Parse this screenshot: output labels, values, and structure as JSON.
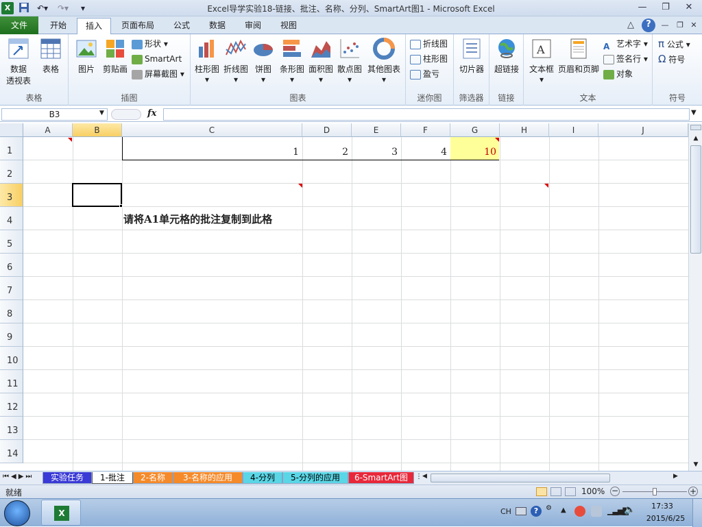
{
  "window": {
    "title": "Excel导学实验18-链接、批注、名称、分列、SmartArt图1 - Microsoft Excel",
    "minimize": "—",
    "restore": "❐",
    "close": "✕"
  },
  "ribbon_tabs": [
    "文件",
    "开始",
    "插入",
    "页面布局",
    "公式",
    "数据",
    "审阅",
    "视图"
  ],
  "active_tab": "插入",
  "help_icons": {
    "up": "△",
    "help": "?",
    "min": "—",
    "restore": "❐",
    "close": "✕"
  },
  "groups": {
    "tables": {
      "label": "表格",
      "pivot": "数据\n透视表",
      "pivot_line1": "数据",
      "pivot_line2": "透视表",
      "table": "表格"
    },
    "illustrations": {
      "label": "插图",
      "picture": "图片",
      "clipart": "剪贴画",
      "shapes": "形状",
      "smartart": "SmartArt",
      "screenshot": "屏幕截图"
    },
    "charts": {
      "label": "图表",
      "column": "柱形图",
      "line": "折线图",
      "pie": "饼图",
      "bar": "条形图",
      "area": "面积图",
      "scatter": "散点图",
      "other": "其他图表"
    },
    "sparklines": {
      "label": "迷你图",
      "line": "折线图",
      "column": "柱形图",
      "winloss": "盈亏"
    },
    "filter": {
      "label": "筛选器",
      "slicer": "切片器"
    },
    "links": {
      "label": "链接",
      "hyperlink": "超链接"
    },
    "text": {
      "label": "文本",
      "textbox": "文本框",
      "header_footer": "页眉和页脚",
      "wordart": "艺术字",
      "signature": "签名行",
      "object": "对象"
    },
    "symbols": {
      "label": "符号",
      "equation": "公式",
      "symbol": "符号"
    }
  },
  "formula_bar": {
    "name_box": "B3",
    "fx": "fx",
    "formula": ""
  },
  "columns": [
    "A",
    "B",
    "C",
    "D",
    "E",
    "F",
    "G",
    "H",
    "I",
    "J"
  ],
  "rows": [
    "1",
    "2",
    "3",
    "4",
    "5",
    "6",
    "7",
    "8",
    "9",
    "10",
    "11",
    "12",
    "13",
    "14"
  ],
  "cells": {
    "C1": "1",
    "D1": "2",
    "E1": "3",
    "F1": "4",
    "G1": "10",
    "C4": "请将A1单元格的批注复制到此格"
  },
  "colors": {
    "g1_fill": "#ffff99",
    "g1_text": "#c00000",
    "selected_header": "#f8cf63"
  },
  "sheet_tabs": [
    {
      "label": "实验任务",
      "bg": "#3a3ad6",
      "fg": "#ffffff"
    },
    {
      "label": "1-批注",
      "bg": "#ffffff",
      "fg": "#000000",
      "active": true
    },
    {
      "label": "2-名称",
      "bg": "#f58a2a",
      "fg": "#ffffff"
    },
    {
      "label": "3-名称的应用",
      "bg": "#f58a2a",
      "fg": "#ffffff"
    },
    {
      "label": "4-分列",
      "bg": "#5ad6e6",
      "fg": "#000000"
    },
    {
      "label": "5-分列的应用",
      "bg": "#5ad6e6",
      "fg": "#000000"
    },
    {
      "label": "6-SmartArt图",
      "bg": "#e8283a",
      "fg": "#ffffff"
    }
  ],
  "status": {
    "ready": "就绪",
    "zoom": "100%",
    "zoom_level": 100
  },
  "taskbar": {
    "lang": "CH",
    "time": "17:33",
    "date": "2015/6/25"
  }
}
